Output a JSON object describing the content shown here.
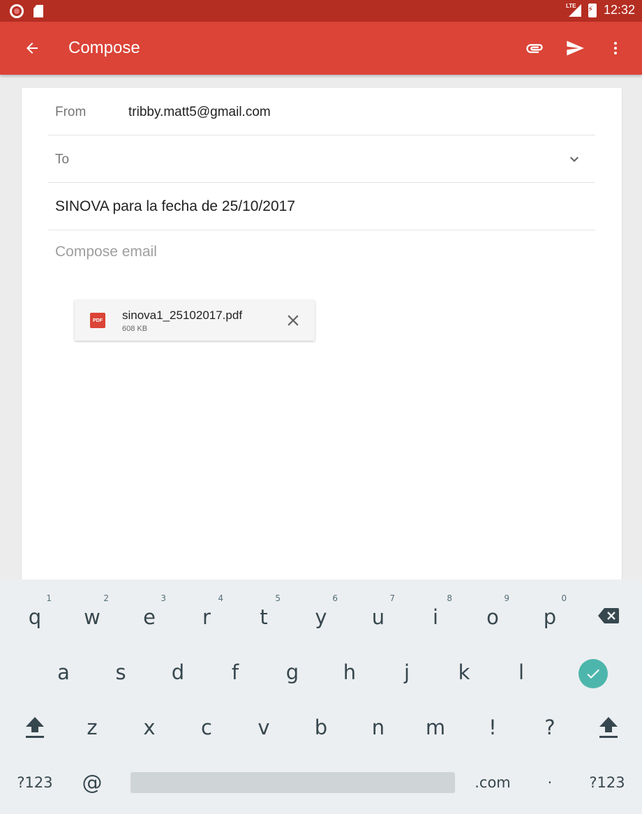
{
  "status_bar": {
    "time": "12:32",
    "network": "LTE"
  },
  "app_bar": {
    "title": "Compose"
  },
  "compose": {
    "from_label": "From",
    "from_value": "tribby.matt5@gmail.com",
    "to_label": "To",
    "subject": "SINOVA para la fecha de 25/10/2017",
    "body_placeholder": "Compose email"
  },
  "attachment": {
    "icon_label": "PDF",
    "name": "sinova1_25102017.pdf",
    "size": "608 KB"
  },
  "keyboard": {
    "row1": [
      {
        "key": "q",
        "hint": "1"
      },
      {
        "key": "w",
        "hint": "2"
      },
      {
        "key": "e",
        "hint": "3"
      },
      {
        "key": "r",
        "hint": "4"
      },
      {
        "key": "t",
        "hint": "5"
      },
      {
        "key": "y",
        "hint": "6"
      },
      {
        "key": "u",
        "hint": "7"
      },
      {
        "key": "i",
        "hint": "8"
      },
      {
        "key": "o",
        "hint": "9"
      },
      {
        "key": "p",
        "hint": "0"
      }
    ],
    "row2": [
      "a",
      "s",
      "d",
      "f",
      "g",
      "h",
      "j",
      "k",
      "l"
    ],
    "row3": [
      "z",
      "x",
      "c",
      "v",
      "b",
      "n",
      "m",
      "!",
      "?"
    ],
    "row4": {
      "symbols_left": "?123",
      "at": "@",
      "dotcom": ".com",
      "dot": "·",
      "symbols_right": "?123"
    }
  },
  "colors": {
    "status_bar": "#b52e22",
    "app_bar": "#db4437",
    "done_key": "#4db6ac"
  },
  "icons": [
    "back-arrow-icon",
    "attach-icon",
    "send-icon",
    "more-vert-icon",
    "chevron-down-icon",
    "pdf-icon",
    "close-icon",
    "backspace-icon",
    "shift-icon",
    "check-icon"
  ]
}
